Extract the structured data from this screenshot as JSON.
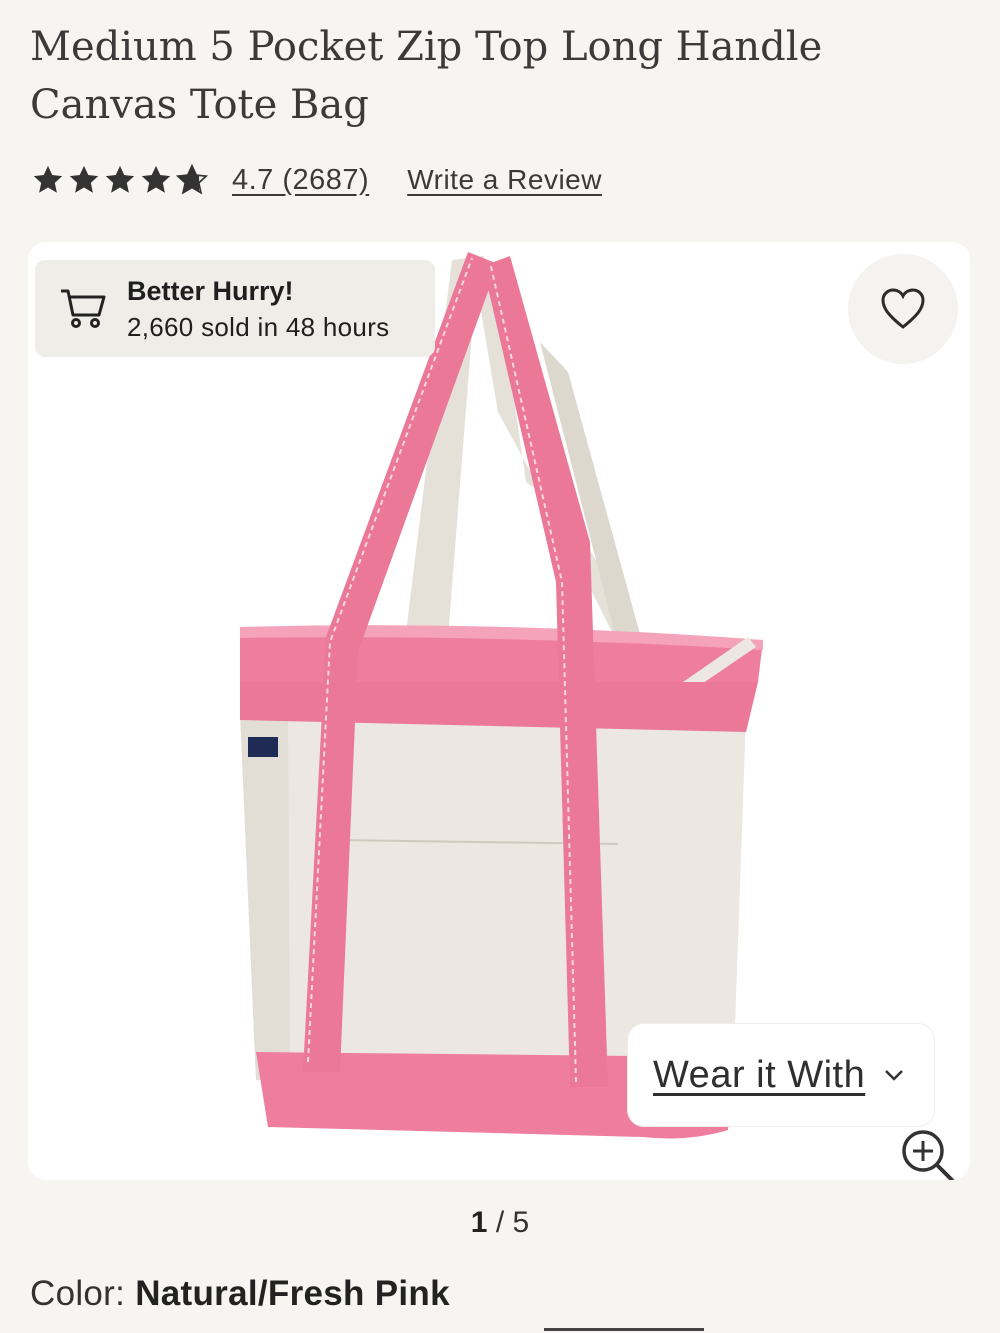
{
  "product": {
    "title": "Medium 5 Pocket Zip Top Long Handle Canvas Tote Bag"
  },
  "rating": {
    "stars": 4.7,
    "label": "4.7 (2687)",
    "write_review": "Write a Review"
  },
  "badge": {
    "icon": "cart-icon",
    "title": "Better Hurry!",
    "subtitle": "2,660 sold in 48 hours"
  },
  "image": {
    "favorite_icon": "heart-icon",
    "wear_it_with": "Wear it With",
    "zoom_icon": "zoom-in-icon",
    "colors": {
      "pink": "#ee7d9e",
      "natural": "#ece8e1"
    }
  },
  "pager": {
    "current": "1",
    "separator": " / ",
    "total": "5"
  },
  "color": {
    "label": "Color: ",
    "value": "Natural/Fresh Pink"
  }
}
